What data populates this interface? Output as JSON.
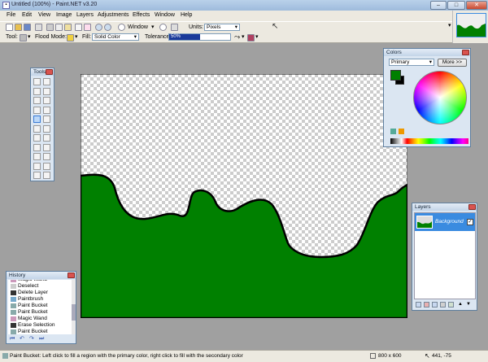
{
  "window": {
    "title": "Untitled (100%) - Paint.NET v3.20",
    "minimize": "–",
    "maximize": "□",
    "close": "✕"
  },
  "menu": [
    "File",
    "Edit",
    "View",
    "Image",
    "Layers",
    "Adjustments",
    "Effects",
    "Window",
    "Help"
  ],
  "toolbar": {
    "zoom_value": "Window",
    "units_label": "Units:",
    "units_value": "Pixels",
    "tool_label": "Tool:",
    "flood_label": "Flood Mode:",
    "fill_label": "Fill:",
    "fill_value": "Solid Color",
    "tolerance_label": "Tolerance:",
    "tolerance_value": "50%",
    "tolerance_fraction": 0.5
  },
  "tools_panel": {
    "title": "Tools"
  },
  "colors_panel": {
    "title": "Colors",
    "mode": "Primary",
    "more_button": "More >>",
    "primary_color": "#008000",
    "secondary_color": "#000000"
  },
  "layers_panel": {
    "title": "Layers",
    "layers": [
      {
        "name": "Background",
        "visible": true
      }
    ]
  },
  "history_panel": {
    "title": "History",
    "items": [
      "Magic Wand",
      "Deselect",
      "Delete Layer",
      "Paintbrush",
      "Paint Bucket",
      "Paint Bucket",
      "Magic Wand",
      "Erase Selection",
      "Paint Bucket"
    ]
  },
  "status": {
    "message": "Paint Bucket: Left click to fill a region with the primary color, right click to fill with the secondary color",
    "image_size": "800 x 600",
    "cursor_pos": "441, -75"
  },
  "colors": {
    "canvas_fill": "#008000",
    "accent": "#3a8be0"
  }
}
